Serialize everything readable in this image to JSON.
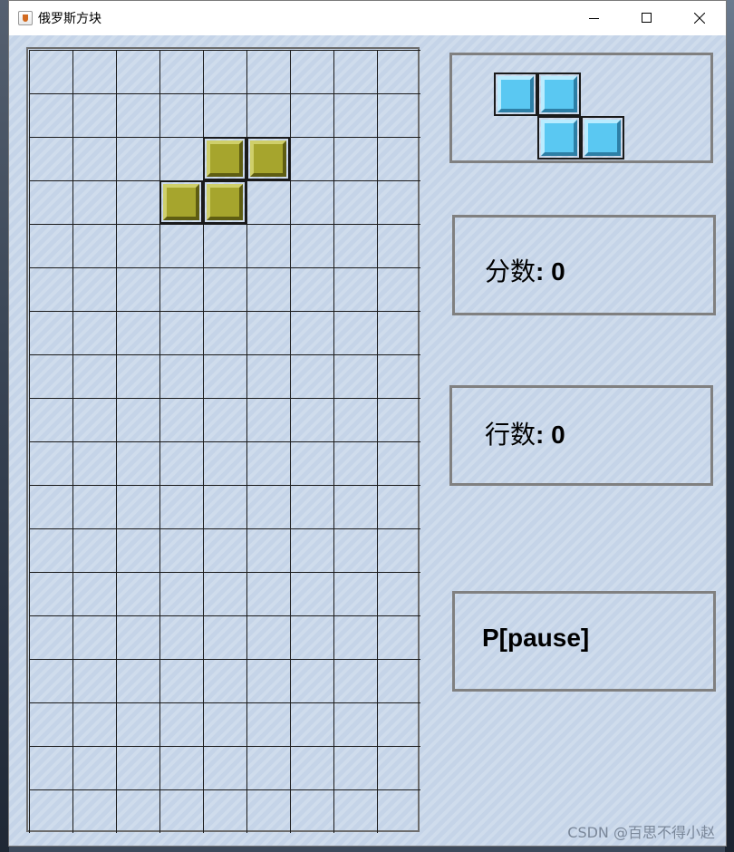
{
  "window": {
    "title": "俄罗斯方块",
    "controls": [
      "minimize",
      "maximize",
      "close"
    ]
  },
  "board": {
    "columns": 9,
    "rows": 18,
    "current_piece": {
      "shape": "S",
      "color": "#a6a52d",
      "cells": [
        [
          4,
          2
        ],
        [
          5,
          2
        ],
        [
          3,
          3
        ],
        [
          4,
          3
        ]
      ]
    }
  },
  "next_piece": {
    "shape": "Z",
    "color": "#5ac8f2",
    "cells": [
      [
        0,
        0
      ],
      [
        1,
        0
      ],
      [
        1,
        1
      ],
      [
        2,
        1
      ]
    ]
  },
  "score": {
    "label": "分数",
    "value": "0"
  },
  "lines": {
    "label": "行数",
    "value": "0"
  },
  "pause": {
    "text": "P[pause]"
  },
  "watermark": "CSDN @百思不得小赵"
}
